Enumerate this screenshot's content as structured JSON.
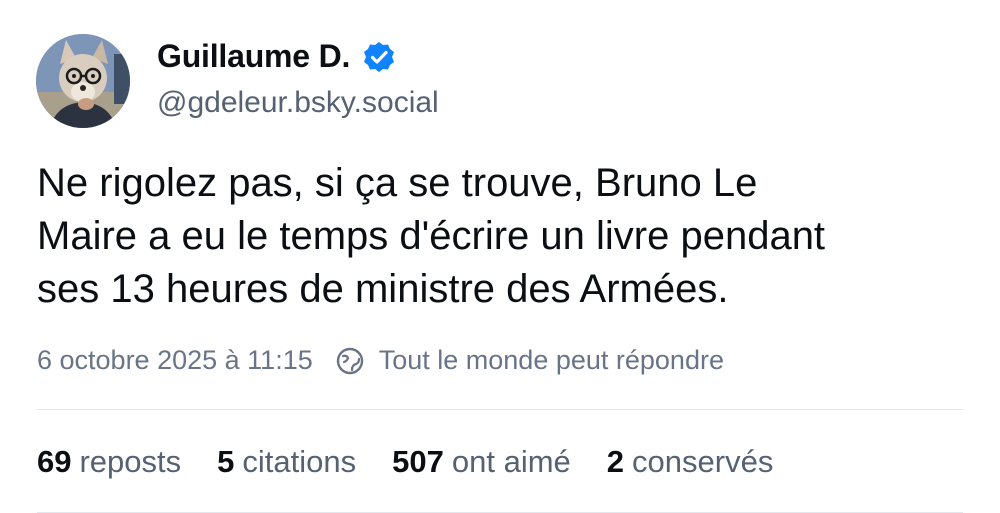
{
  "author": {
    "display_name": "Guillaume D.",
    "handle": "@gdeleur.bsky.social",
    "verified_icon": "verified-check-icon",
    "avatar_icon": "fox-avatar"
  },
  "post": {
    "text": "Ne rigolez pas, si ça se trouve, Bruno Le\nMaire a eu le temps d'écrire un livre pendant\nses 13 heures de ministre des Armées."
  },
  "meta": {
    "date": "6 octobre 2025 à 11:15",
    "reply_setting": "Tout le monde peut répondre",
    "reply_icon": "globe-icon"
  },
  "stats": [
    {
      "count": "69",
      "label": "reposts"
    },
    {
      "count": "5",
      "label": "citations"
    },
    {
      "count": "507",
      "label": "ont aimé"
    },
    {
      "count": "2",
      "label": "conservés"
    }
  ],
  "colors": {
    "text": "#0b0f14",
    "secondary": "#566172",
    "meta": "#697587",
    "verified": "#1083fe",
    "divider": "#e3e8ee"
  }
}
